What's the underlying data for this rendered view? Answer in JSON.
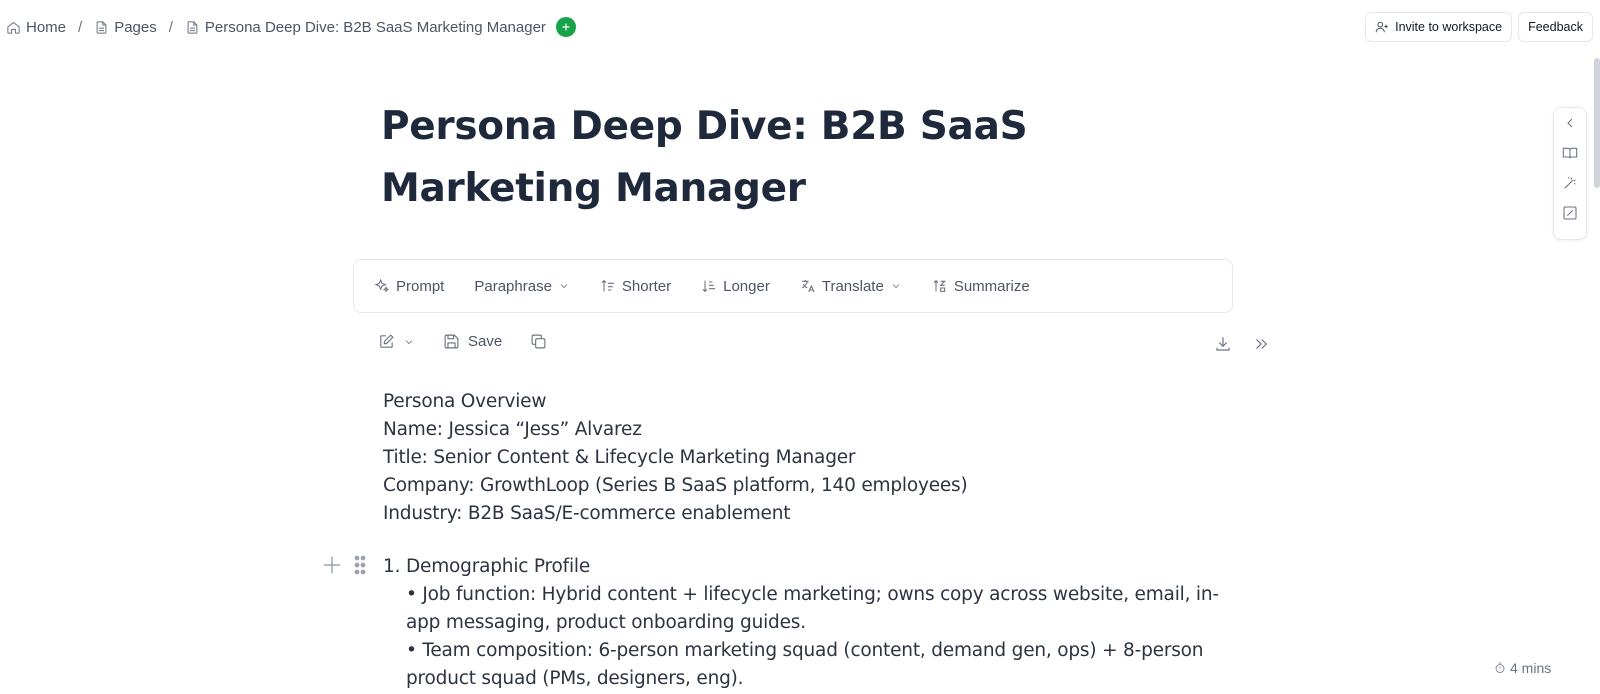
{
  "breadcrumb": {
    "home": "Home",
    "pages": "Pages",
    "current": "Persona Deep Dive: B2B SaaS Marketing Manager",
    "separator": "/"
  },
  "header_actions": {
    "invite": "Invite to workspace",
    "feedback": "Feedback"
  },
  "page": {
    "title": "Persona Deep Dive: B2B SaaS Marketing Manager"
  },
  "ai_toolbar": {
    "prompt": "Prompt",
    "paraphrase": "Paraphrase",
    "shorter": "Shorter",
    "longer": "Longer",
    "translate": "Translate",
    "summarize": "Summarize"
  },
  "edit_toolbar": {
    "save": "Save"
  },
  "content": {
    "overview_lines": [
      "Persona Overview",
      "Name: Jessica “Jess” Alvarez",
      "Title: Senior Content & Lifecycle Marketing Manager",
      "Company: GrowthLoop (Series B SaaS platform, 140 employees)",
      "Industry: B2B SaaS/E-commerce enablement"
    ],
    "section1": {
      "number": "1.",
      "heading": "Demographic Profile",
      "bullets": [
        "• Job function: Hybrid content + lifecycle marketing; owns copy across website, email, in-app messaging, product onboarding guides.",
        "• Team composition: 6-person marketing squad (content, demand gen, ops) + 8-person product squad (PMs, designers, eng)."
      ]
    }
  },
  "footer": {
    "read_time": "4 mins"
  },
  "colors": {
    "accent_green": "#16a34a",
    "title": "#1e293b",
    "border": "#e5e7eb"
  }
}
